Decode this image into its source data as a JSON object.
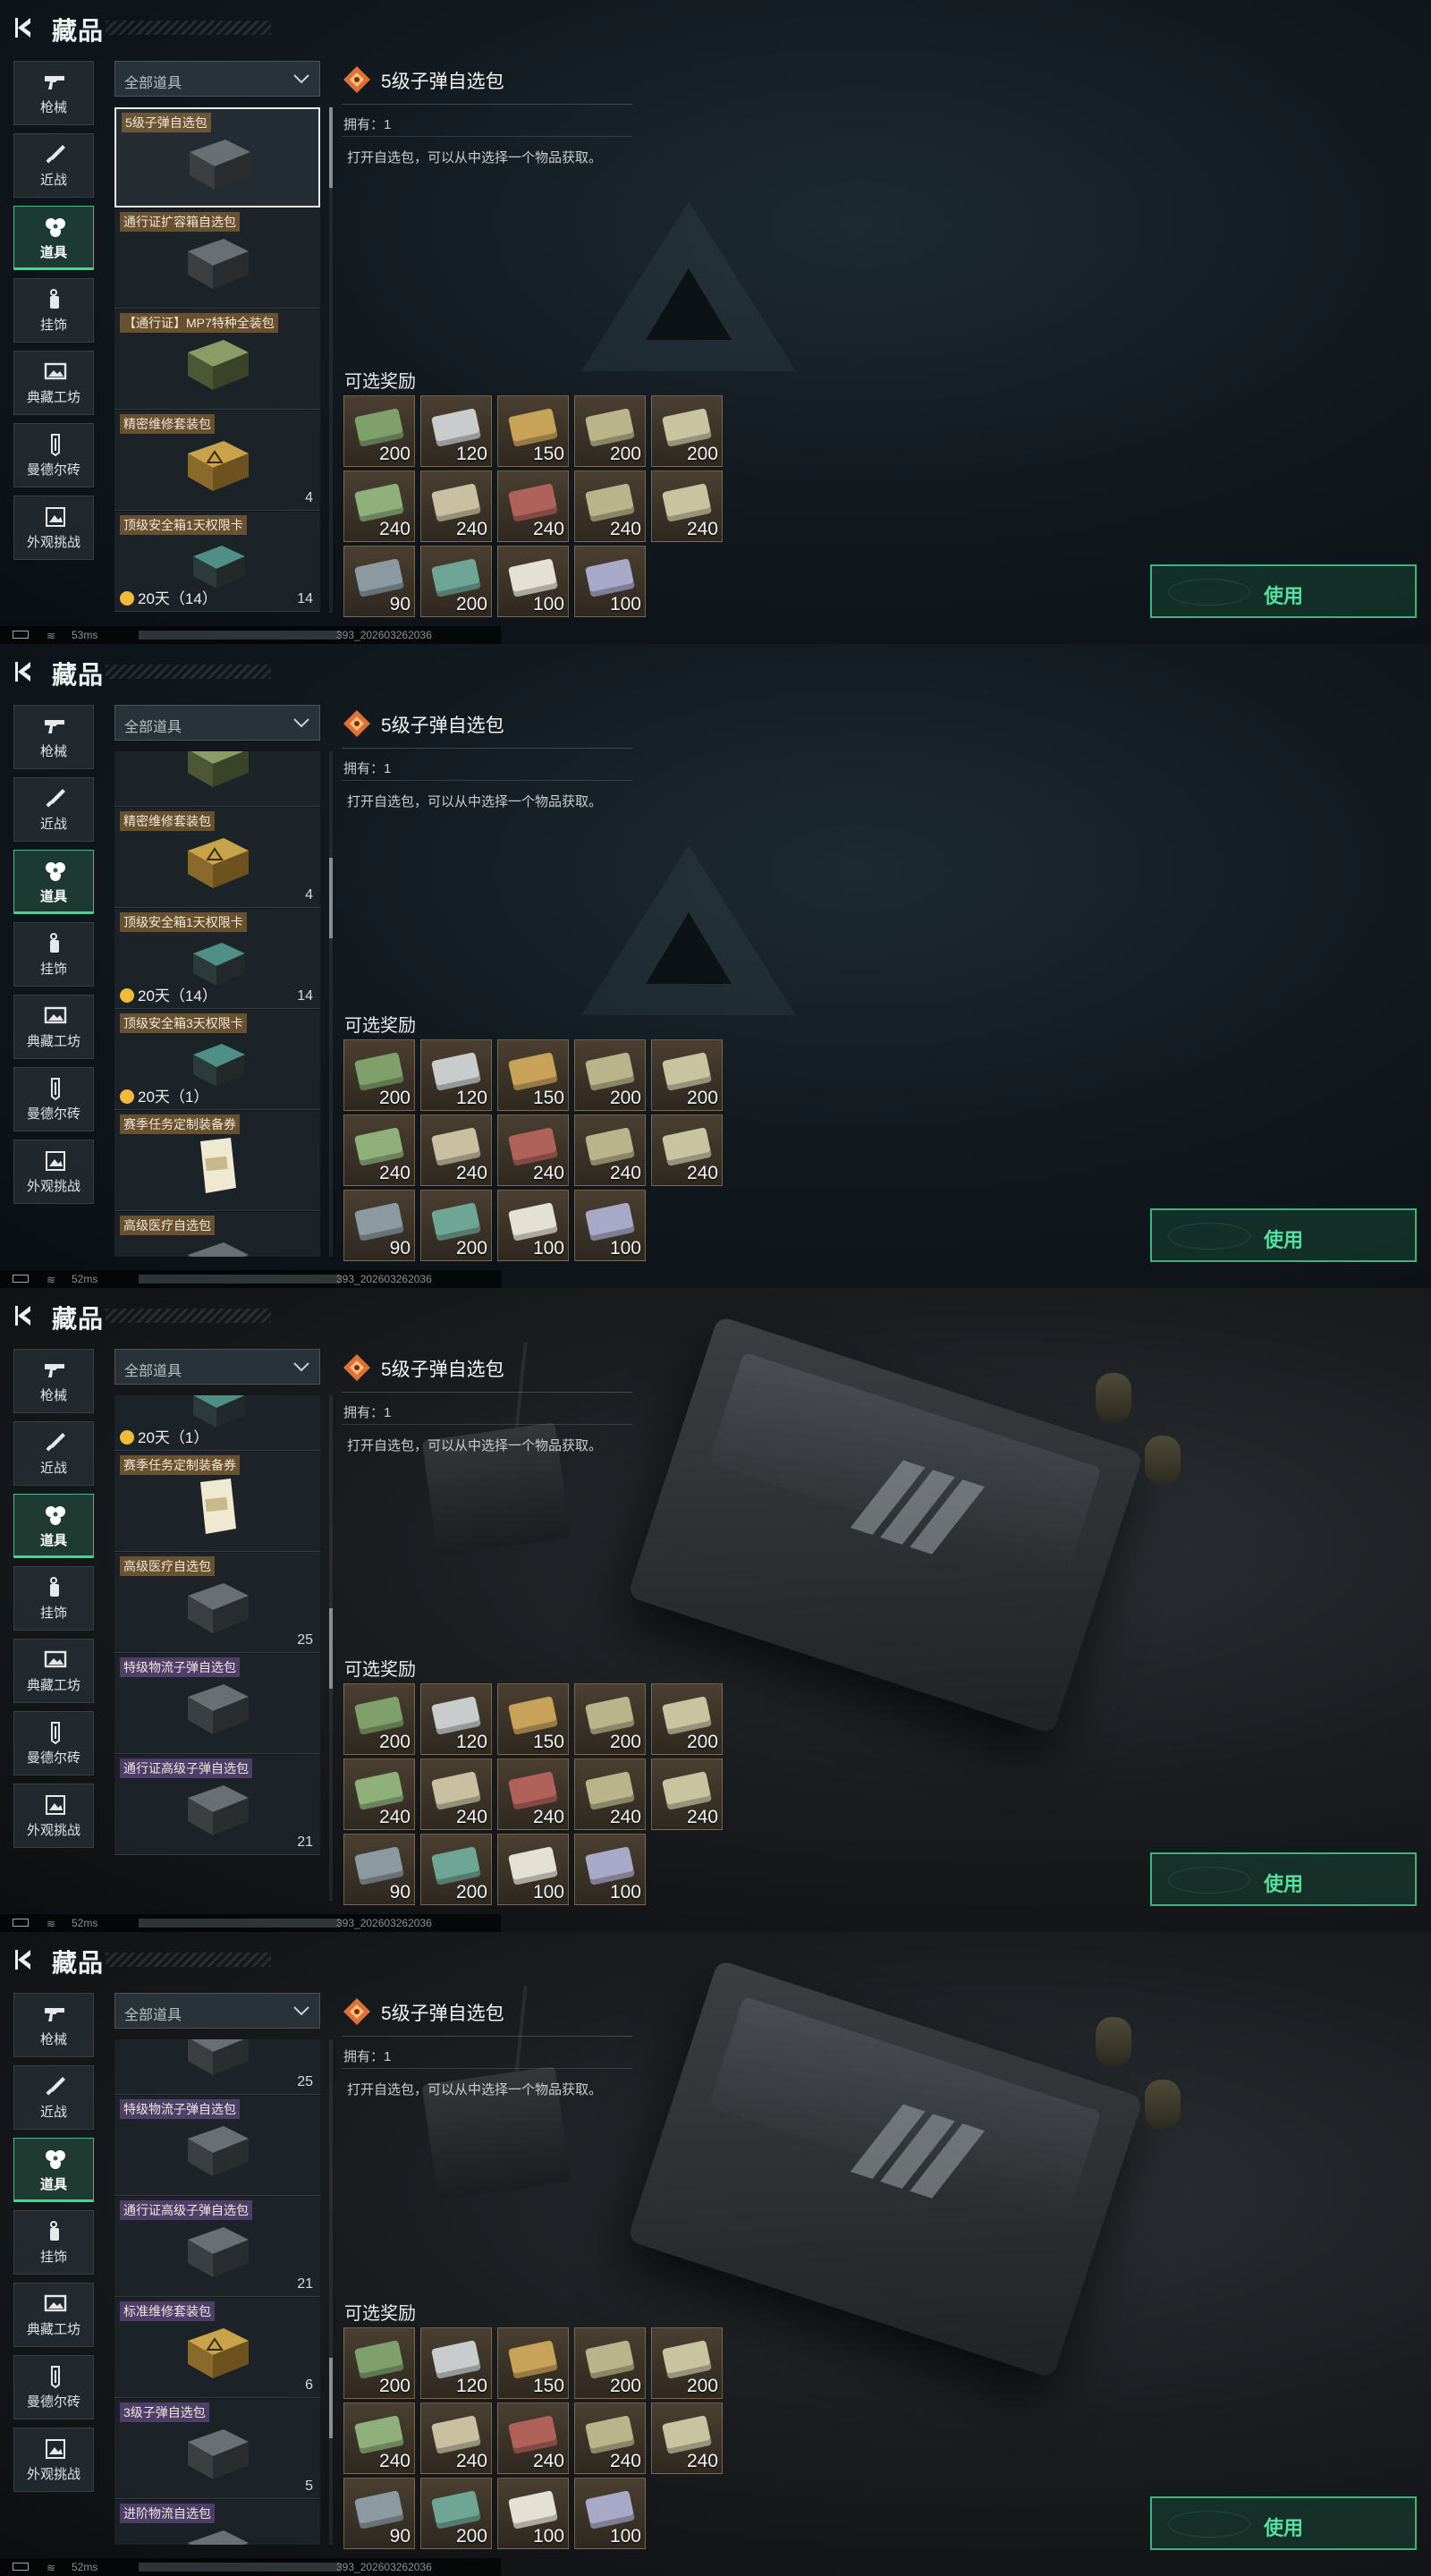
{
  "frames": [
    {
      "background": "dark",
      "header": {
        "title": "藏品"
      },
      "nav": [
        {
          "label": "枪械",
          "icon": "gun-icon",
          "active": false
        },
        {
          "label": "近战",
          "icon": "knife-icon",
          "active": false
        },
        {
          "label": "道具",
          "icon": "items-icon",
          "active": true
        },
        {
          "label": "挂饰",
          "icon": "charm-icon",
          "active": false
        },
        {
          "label": "典藏工坊",
          "icon": "workshop-icon",
          "active": false
        },
        {
          "label": "曼德尔砖",
          "icon": "brick-icon",
          "active": false
        },
        {
          "label": "外观挑战",
          "icon": "challenge-icon",
          "active": false
        }
      ],
      "filter": {
        "label": "全部道具"
      },
      "list": [
        {
          "name": "5级子弹自选包",
          "quality": "gold",
          "count": "",
          "timer": "",
          "selected": true,
          "art": "dark-case"
        },
        {
          "name": "通行证扩容箱自选包",
          "quality": "gold",
          "count": "",
          "timer": "",
          "selected": false,
          "art": "dark-case"
        },
        {
          "name": "【通行证】MP7特种全装包",
          "quality": "gold",
          "count": "",
          "timer": "",
          "selected": false,
          "art": "green-case"
        },
        {
          "name": "精密维修套装包",
          "quality": "gold",
          "count": "4",
          "timer": "",
          "selected": false,
          "art": "yellow-case"
        },
        {
          "name": "顶级安全箱1天权限卡",
          "quality": "gold",
          "count": "14",
          "timer": "20天（14）",
          "selected": false,
          "art": "teal-box"
        }
      ],
      "scroll_position": 0.0,
      "status": {
        "ping": "53ms",
        "session_id": "393_202603262036"
      }
    },
    {
      "background": "dark",
      "header": {
        "title": "藏品"
      },
      "nav": [
        {
          "label": "枪械",
          "icon": "gun-icon",
          "active": false
        },
        {
          "label": "近战",
          "icon": "knife-icon",
          "active": false
        },
        {
          "label": "道具",
          "icon": "items-icon",
          "active": true
        },
        {
          "label": "挂饰",
          "icon": "charm-icon",
          "active": false
        },
        {
          "label": "典藏工坊",
          "icon": "workshop-icon",
          "active": false
        },
        {
          "label": "曼德尔砖",
          "icon": "brick-icon",
          "active": false
        },
        {
          "label": "外观挑战",
          "icon": "challenge-icon",
          "active": false
        }
      ],
      "filter": {
        "label": "全部道具"
      },
      "list": [
        {
          "name": "",
          "quality": "gold",
          "count": "",
          "timer": "",
          "selected": false,
          "art": "green-case"
        },
        {
          "name": "精密维修套装包",
          "quality": "gold",
          "count": "4",
          "timer": "",
          "selected": false,
          "art": "yellow-case"
        },
        {
          "name": "顶级安全箱1天权限卡",
          "quality": "gold",
          "count": "14",
          "timer": "20天（14）",
          "selected": false,
          "art": "teal-box"
        },
        {
          "name": "顶级安全箱3天权限卡",
          "quality": "gold",
          "count": "",
          "timer": "20天（1）",
          "selected": false,
          "art": "teal-box"
        },
        {
          "name": "赛季任务定制装备券",
          "quality": "gold",
          "count": "",
          "timer": "",
          "selected": false,
          "art": "ticket"
        },
        {
          "name": "高级医疗自选包",
          "quality": "gold",
          "count": "",
          "timer": "",
          "selected": false,
          "art": "dark-case"
        }
      ],
      "scroll_position": 0.25,
      "status": {
        "ping": "52ms",
        "session_id": "393_202603262036"
      }
    },
    {
      "background": "photo",
      "header": {
        "title": "藏品"
      },
      "nav": [
        {
          "label": "枪械",
          "icon": "gun-icon",
          "active": false
        },
        {
          "label": "近战",
          "icon": "knife-icon",
          "active": false
        },
        {
          "label": "道具",
          "icon": "items-icon",
          "active": true
        },
        {
          "label": "挂饰",
          "icon": "charm-icon",
          "active": false
        },
        {
          "label": "典藏工坊",
          "icon": "workshop-icon",
          "active": false
        },
        {
          "label": "曼德尔砖",
          "icon": "brick-icon",
          "active": false
        },
        {
          "label": "外观挑战",
          "icon": "challenge-icon",
          "active": false
        }
      ],
      "filter": {
        "label": "全部道具"
      },
      "list": [
        {
          "name": "",
          "quality": "gold",
          "count": "",
          "timer": "20天（1）",
          "selected": false,
          "art": "teal-box"
        },
        {
          "name": "赛季任务定制装备券",
          "quality": "gold",
          "count": "",
          "timer": "",
          "selected": false,
          "art": "ticket"
        },
        {
          "name": "高级医疗自选包",
          "quality": "gold",
          "count": "25",
          "timer": "",
          "selected": false,
          "art": "dark-case"
        },
        {
          "name": "特级物流子弹自选包",
          "quality": "purple",
          "count": "",
          "timer": "",
          "selected": false,
          "art": "dark-case"
        },
        {
          "name": "通行证高级子弹自选包",
          "quality": "purple",
          "count": "21",
          "timer": "",
          "selected": false,
          "art": "dark-case"
        }
      ],
      "scroll_position": 0.5,
      "status": {
        "ping": "52ms",
        "session_id": "393_202603262036"
      }
    },
    {
      "background": "photo",
      "header": {
        "title": "藏品"
      },
      "nav": [
        {
          "label": "枪械",
          "icon": "gun-icon",
          "active": false
        },
        {
          "label": "近战",
          "icon": "knife-icon",
          "active": false
        },
        {
          "label": "道具",
          "icon": "items-icon",
          "active": true
        },
        {
          "label": "挂饰",
          "icon": "charm-icon",
          "active": false
        },
        {
          "label": "典藏工坊",
          "icon": "workshop-icon",
          "active": false
        },
        {
          "label": "曼德尔砖",
          "icon": "brick-icon",
          "active": false
        },
        {
          "label": "外观挑战",
          "icon": "challenge-icon",
          "active": false
        }
      ],
      "filter": {
        "label": "全部道具"
      },
      "list": [
        {
          "name": "",
          "quality": "purple",
          "count": "25",
          "timer": "",
          "selected": false,
          "art": "dark-case"
        },
        {
          "name": "特级物流子弹自选包",
          "quality": "purple",
          "count": "",
          "timer": "",
          "selected": false,
          "art": "dark-case"
        },
        {
          "name": "通行证高级子弹自选包",
          "quality": "purple",
          "count": "21",
          "timer": "",
          "selected": false,
          "art": "dark-case"
        },
        {
          "name": "标准维修套装包",
          "quality": "purple",
          "count": "6",
          "timer": "",
          "selected": false,
          "art": "yellow-case"
        },
        {
          "name": "3级子弹自选包",
          "quality": "purple",
          "count": "5",
          "timer": "",
          "selected": false,
          "art": "dark-case"
        },
        {
          "name": "进阶物流自选包",
          "quality": "purple",
          "count": "",
          "timer": "",
          "selected": false,
          "art": "dark-case"
        }
      ],
      "scroll_position": 0.75,
      "status": {
        "ping": "52ms",
        "session_id": "393_202603262036"
      }
    }
  ],
  "detail": {
    "title": "5级子弹自选包",
    "owned": "拥有：1",
    "description": "打开自选包，可以从中选择一个物品获取。"
  },
  "rewards_label": "可选奖励",
  "rewards": [
    {
      "qty": "200",
      "color": "#7fa06a"
    },
    {
      "qty": "120",
      "color": "#c9cccc"
    },
    {
      "qty": "150",
      "color": "#c9a25a"
    },
    {
      "qty": "200",
      "color": "#b9b48a"
    },
    {
      "qty": "200",
      "color": "#c8c4a0"
    },
    {
      "qty": "240",
      "color": "#8fb07a"
    },
    {
      "qty": "240",
      "color": "#c8c0a0"
    },
    {
      "qty": "240",
      "color": "#b0625a"
    },
    {
      "qty": "240",
      "color": "#b9b48a"
    },
    {
      "qty": "240",
      "color": "#c8c4a0"
    },
    {
      "qty": "90",
      "color": "#8a9aa0"
    },
    {
      "qty": "200",
      "color": "#6fa595"
    },
    {
      "qty": "100",
      "color": "#e4e0d4"
    },
    {
      "qty": "100",
      "color": "#a8a9c8"
    }
  ],
  "use_button": {
    "label": "使用"
  },
  "colors": {
    "accent": "#46d394",
    "gold_tag": "#aa7837",
    "purple_tag": "#6e5096"
  }
}
